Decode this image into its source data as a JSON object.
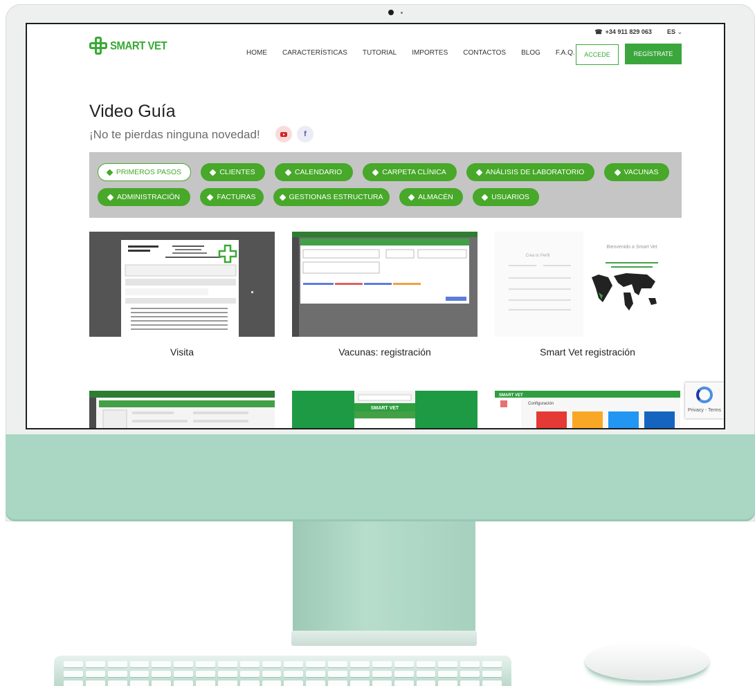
{
  "topbar": {
    "phone": "+34 911 829 063",
    "language": "ES"
  },
  "brand": {
    "name": "SMART VET",
    "color": "#39a935"
  },
  "nav": {
    "items": [
      "HOME",
      "CARACTERÍSTICAS",
      "TUTORIAL",
      "IMPORTES",
      "CONTACTOS",
      "BLOG",
      "F.A.Q."
    ]
  },
  "auth": {
    "login": "ACCEDE",
    "register": "REGÍSTRATE"
  },
  "page": {
    "title": "Video Guía",
    "subtitle": "¡No te pierdas ninguna novedad!"
  },
  "social": {
    "youtube_icon": "youtube-icon",
    "facebook_icon": "facebook-icon",
    "facebook_glyph": "f"
  },
  "tags": [
    {
      "label": "PRIMEROS PASOS",
      "active": true
    },
    {
      "label": "CLIENTES",
      "active": false
    },
    {
      "label": "CALENDARIO",
      "active": false
    },
    {
      "label": "CARPETA CLÍNICA",
      "active": false
    },
    {
      "label": "ANÁLISIS DE LABORATORIO",
      "active": false
    },
    {
      "label": "VACUNAS",
      "active": false
    },
    {
      "label": "ADMINISTRACIÓN",
      "active": false
    },
    {
      "label": "FACTURAS",
      "active": false
    },
    {
      "label": "GESTIONAS ESTRUCTURA",
      "active": false
    },
    {
      "label": "ALMACÉN",
      "active": false
    },
    {
      "label": "USUARIOS",
      "active": false
    }
  ],
  "videos": [
    {
      "caption": "Visita",
      "thumb_heading": "INFORME VISITA CLÍNICA"
    },
    {
      "caption": "Vacunas: registración"
    },
    {
      "caption": "Smart Vet registración",
      "thumb_heading": "Bienvenido a Smart Vet",
      "thumb_subheading": "Crea tu Perfil"
    }
  ],
  "videos_row2": [
    {
      "thumb_text": ""
    },
    {
      "thumb_text": "SMART VET"
    },
    {
      "thumb_text": "SMART VET",
      "thumb_subtitle": "Configuración"
    }
  ],
  "recaptcha": {
    "text": "Privacy - Terms"
  },
  "colors": {
    "accent": "#47a82a",
    "tag_band": "#c5c5c5",
    "device": "#a9d7c3"
  }
}
